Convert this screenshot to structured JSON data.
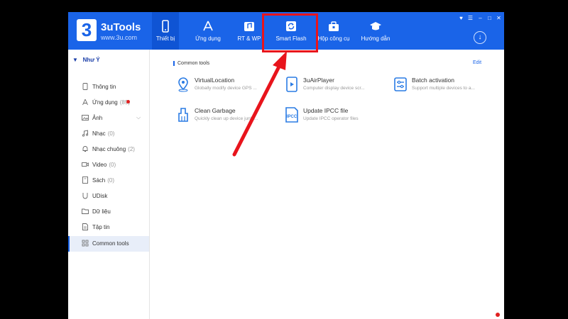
{
  "app": {
    "name": "3uTools",
    "url": "www.3u.com",
    "logo_char": "3"
  },
  "tabs": [
    {
      "label": "Thiết bị",
      "icon": "phone-icon",
      "active": true
    },
    {
      "label": "Ứng dụng",
      "icon": "app-store-icon"
    },
    {
      "label": "RT & WP",
      "icon": "ringtone-wallpaper-icon"
    },
    {
      "label": "Smart Flash",
      "icon": "refresh-icon"
    },
    {
      "label": "Hộp công cụ",
      "icon": "toolbox-icon"
    },
    {
      "label": "Hướng dẫn",
      "icon": "graduation-cap-icon"
    }
  ],
  "device_name": "Như Ý",
  "sidebar": [
    {
      "label": "Thông tin",
      "icon": "phone-icon"
    },
    {
      "label": "Ứng dụng",
      "count": "(89)",
      "icon": "app-icon",
      "badge": true
    },
    {
      "label": "Ảnh",
      "icon": "photo-icon",
      "expandable": true
    },
    {
      "label": "Nhạc",
      "count": "(0)",
      "icon": "music-icon"
    },
    {
      "label": "Nhạc chuông",
      "count": "(2)",
      "icon": "bell-icon"
    },
    {
      "label": "Video",
      "count": "(0)",
      "icon": "video-icon"
    },
    {
      "label": "Sách",
      "count": "(0)",
      "icon": "book-icon"
    },
    {
      "label": "UDisk",
      "icon": "udisk-icon"
    },
    {
      "label": "Dữ liệu",
      "icon": "folder-icon"
    },
    {
      "label": "Tập tin",
      "icon": "file-icon"
    },
    {
      "label": "Common tools",
      "icon": "grid-icon",
      "active": true
    }
  ],
  "main": {
    "section_title": "Common tools",
    "edit_label": "Edit",
    "tools": [
      {
        "name": "VirtualLocation",
        "desc": "Globally modify device GPS ...",
        "icon": "location-pin-icon"
      },
      {
        "name": "3uAirPlayer",
        "desc": "Computer display device scr...",
        "icon": "airplayer-icon"
      },
      {
        "name": "Batch activation",
        "desc": "Support multiple devices to a...",
        "icon": "batch-activation-icon"
      },
      {
        "name": "Clean Garbage",
        "desc": "Quickly clean up device junk ...",
        "icon": "broom-icon"
      },
      {
        "name": "Update IPCC file",
        "desc": "Update IPCC operator files",
        "icon": "ipcc-file-icon",
        "icon_text": "IPCC"
      }
    ]
  },
  "colors": {
    "accent": "#1a64e8",
    "highlight": "#e8141c"
  }
}
